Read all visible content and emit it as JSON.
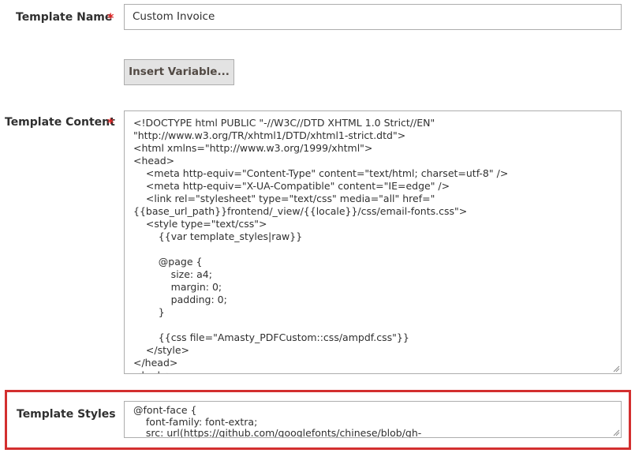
{
  "template_name": {
    "label": "Template Name",
    "required_mark": "*",
    "value": "Custom Invoice"
  },
  "insert_variable": {
    "label": "Insert Variable..."
  },
  "template_content": {
    "label": "Template Content",
    "required_mark": "*",
    "lines": [
      "<!DOCTYPE html PUBLIC \"-//W3C//DTD XHTML 1.0 Strict//EN\"",
      "\"http://www.w3.org/TR/xhtml1/DTD/xhtml1-strict.dtd\">",
      "<html xmlns=\"http://www.w3.org/1999/xhtml\">",
      "<head>",
      "    <meta http-equiv=\"Content-Type\" content=\"text/html; charset=utf-8\" />",
      "    <meta http-equiv=\"X-UA-Compatible\" content=\"IE=edge\" />",
      "    <link rel=\"stylesheet\" type=\"text/css\" media=\"all\" href=\"",
      "{{base_url_path}}frontend/_view/{{locale}}/css/email-fonts.css\">",
      "    <style type=\"text/css\">",
      "        {{var template_styles|raw}}",
      "",
      "        @page {",
      "            size: a4;",
      "            margin: 0;",
      "            padding: 0;",
      "        }",
      "",
      "        {{css file=\"Amasty_PDFCustom::css/ampdf.css\"}}",
      "    </style>",
      "</head>",
      "<body>"
    ]
  },
  "template_styles": {
    "label": "Template Styles",
    "lines": [
      "@font-face {",
      "    font-family: font-extra;",
      "    src: url(https://github.com/googlefonts/chinese/blob/gh-"
    ]
  },
  "colors": {
    "required": "#e22626",
    "highlight": "#d32f2f",
    "button_bg": "#e3e3e3",
    "border": "#adadad"
  }
}
